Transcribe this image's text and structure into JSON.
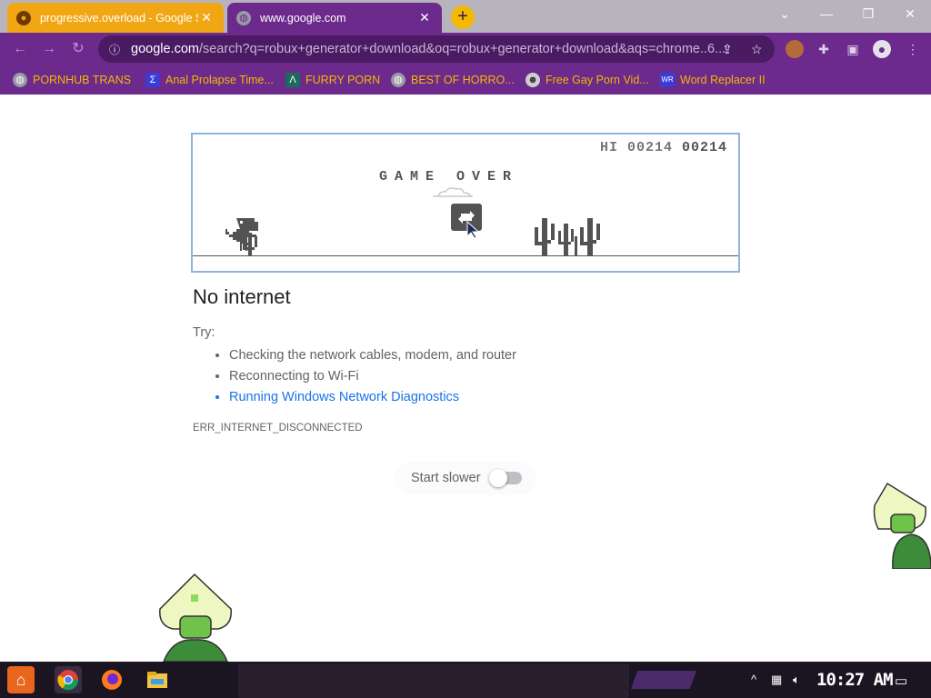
{
  "tabs": [
    {
      "title": "progressive.overload - Google S",
      "close": "✕"
    },
    {
      "title": "www.google.com",
      "close": "✕"
    }
  ],
  "new_tab_label": "+",
  "window_controls": {
    "collapse": "⌄",
    "minimize": "—",
    "restore": "❐",
    "close": "✕"
  },
  "nav": {
    "back": "←",
    "forward": "→",
    "reload": "↻"
  },
  "address": {
    "host": "google.com",
    "rest": "/search?q=robux+generator+download&oq=robux+generator+download&aqs=chrome..6..."
  },
  "bookmarks": [
    {
      "label": "PORNHUB TRANS",
      "icon": "globe-icon"
    },
    {
      "label": "Anal Prolapse Time...",
      "icon": "bracket-icon"
    },
    {
      "label": "FURRY PORN",
      "icon": "chevron-icon"
    },
    {
      "label": "BEST OF HORRO...",
      "icon": "globe-icon"
    },
    {
      "label": "Free Gay Porn Vid...",
      "icon": "alien-icon"
    },
    {
      "label": "Word Replacer II",
      "icon": "wr-icon"
    }
  ],
  "game": {
    "hi_label": "HI",
    "hi_score": "00214",
    "score": "00214",
    "game_over": "GAME OVER"
  },
  "error": {
    "title": "No internet",
    "try_label": "Try:",
    "suggestions": [
      "Checking the network cables, modem, and router",
      "Reconnecting to Wi-Fi",
      "Running Windows Network Diagnostics"
    ],
    "code": "ERR_INTERNET_DISCONNECTED"
  },
  "start_slower": {
    "label": "Start slower",
    "enabled": false
  },
  "taskbar": {
    "clock": "10:27 AM"
  },
  "colors": {
    "chrome_theme": "#6b2a8c",
    "bookmark_text": "#f5b800",
    "tab_orange": "#f1a714",
    "link": "#1a73e8"
  }
}
